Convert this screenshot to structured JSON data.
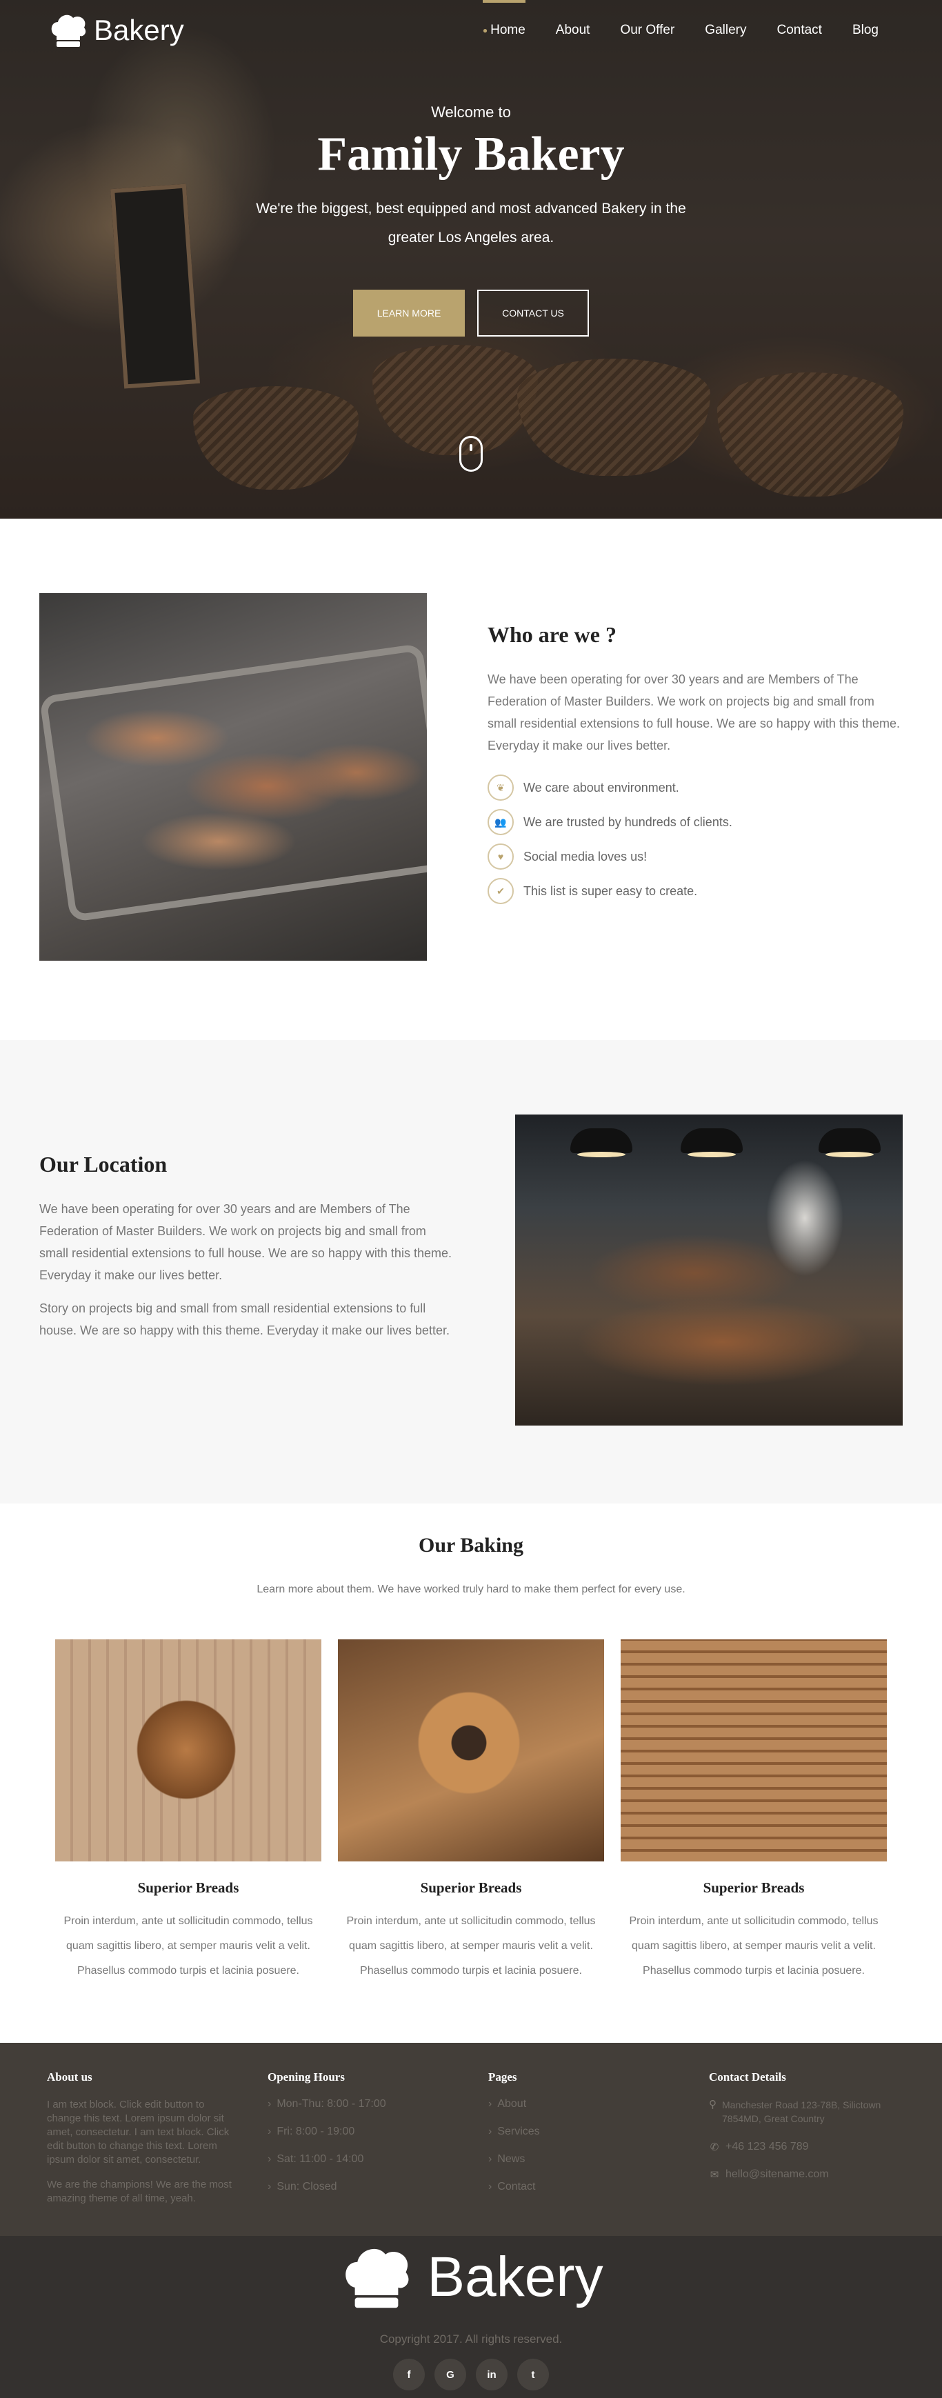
{
  "nav": {
    "brand": "Bakery",
    "items": [
      "Home",
      "About",
      "Our Offer",
      "Gallery",
      "Contact",
      "Blog"
    ]
  },
  "hero": {
    "welcome": "Welcome to",
    "title": "Family Bakery",
    "text": "We're the biggest, best equipped and most advanced Bakery in the greater Los Angeles area.",
    "btn_primary": "LEARN MORE",
    "btn_secondary": "CONTACT US"
  },
  "about": {
    "title": "Who are we ?",
    "text": "We have been operating for over 30 years and are Members of The Federation of Master Builders. We work on projects big and small from small residential extensions to full house. We are so happy with this theme. Everyday it make our lives better.",
    "features": [
      {
        "icon": "leaf-icon",
        "label": "We care about environment."
      },
      {
        "icon": "users-icon",
        "label": "We are trusted by hundreds of clients."
      },
      {
        "icon": "heart-icon",
        "label": "Social media loves us!"
      },
      {
        "icon": "check-icon",
        "label": "This list is super easy to create."
      }
    ]
  },
  "location": {
    "title": "Our Location",
    "para1": "We have been operating for over 30 years and are Members of The Federation of Master Builders. We work on projects big and small from small residential extensions to full house. We are so happy with this theme. Everyday it make our lives better.",
    "para2": "Story on projects big and small from small residential extensions to full house. We are so happy with this theme. Everyday it make our lives better."
  },
  "baking": {
    "title": "Our Baking",
    "subtitle": "Learn more about them. We have worked truly hard to make them perfect for every use.",
    "cards": [
      {
        "title": "Superior Breads",
        "text": "Proin interdum, ante ut sollicitudin commodo, tellus quam sagittis libero, at semper mauris velit a velit. Phasellus commodo turpis et lacinia posuere."
      },
      {
        "title": "Superior Breads",
        "text": "Proin interdum, ante ut sollicitudin commodo, tellus quam sagittis libero, at semper mauris velit a velit. Phasellus commodo turpis et lacinia posuere."
      },
      {
        "title": "Superior Breads",
        "text": "Proin interdum, ante ut sollicitudin commodo, tellus quam sagittis libero, at semper mauris velit a velit. Phasellus commodo turpis et lacinia posuere."
      }
    ]
  },
  "footer": {
    "about_title": "About us",
    "about_text1": "I am text block. Click edit button to change this text. Lorem ipsum dolor sit amet, consectetur. I am text block. Click edit button to change this text. Lorem ipsum dolor sit amet, consectetur.",
    "about_text2": "We are the champions! We are the most amazing theme of all time, yeah.",
    "hours_title": "Opening Hours",
    "hours": [
      "Mon-Thu: 8:00 - 17:00",
      "Fri: 8:00 - 19:00",
      "Sat: 11:00 - 14:00",
      "Sun: Closed"
    ],
    "pages_title": "Pages",
    "pages": [
      "About",
      "Services",
      "News",
      "Contact"
    ],
    "contact_title": "Contact Details",
    "address": "Manchester Road 123-78B, Silictown 7854MD, Great Country",
    "phone": "+46 123 456 789",
    "email": "hello@sitename.com",
    "brand": "Bakery",
    "copyright": "Copyright 2017. All rights reserved.",
    "socials": [
      "f",
      "G",
      "in",
      "t"
    ]
  },
  "colors": {
    "accent": "#b9a36e",
    "footer_top": "#433e39",
    "footer_bottom": "#34312f"
  }
}
